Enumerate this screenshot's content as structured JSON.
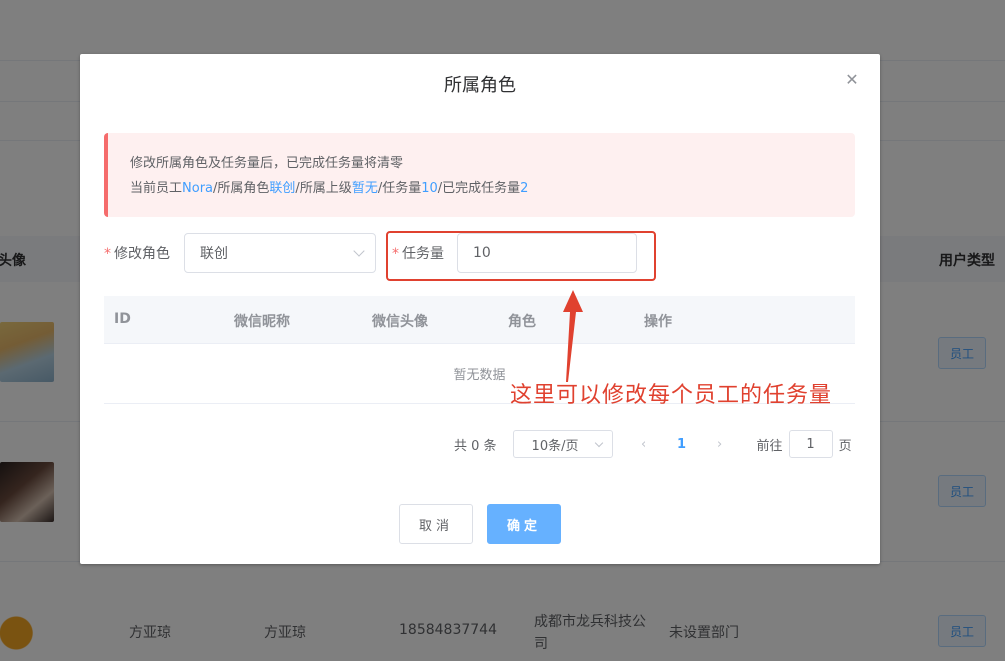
{
  "background": {
    "col_avatar_label": "头像",
    "col_usertype_label": "用户类型",
    "rows": [
      {
        "tag": "员工"
      },
      {
        "tag": "员工"
      },
      {
        "name": "方亚琼",
        "nickname": "方亚琼",
        "phone": "18584837744",
        "company_line1": "成都市龙兵科技公",
        "company_line2": "司",
        "department": "未设置部门",
        "tag": "员工"
      }
    ]
  },
  "dialog": {
    "title": "所属角色",
    "close_icon": "close-icon",
    "alert": {
      "line1": "修改所属角色及任务量后，已完成任务量将清零",
      "prefix_employee": "当前员工",
      "employee": "Nora",
      "prefix_role": "/所属角色",
      "role": "联创",
      "prefix_superior": "/所属上级",
      "superior": "暂无",
      "prefix_task": "/任务量",
      "task": "10",
      "prefix_done": "/已完成任务量",
      "done": "2"
    },
    "form": {
      "role_label": "修改角色",
      "role_value": "联创",
      "task_label": "任务量",
      "task_value": "10"
    },
    "table": {
      "columns": [
        "ID",
        "微信昵称",
        "微信头像",
        "角色",
        "操作"
      ],
      "empty_text": "暂无数据"
    },
    "pagination": {
      "total": "共 0 条",
      "page_size": "10条/页",
      "prev_icon": "‹",
      "current_page": "1",
      "next_icon": "›",
      "goto_label": "前往",
      "goto_value": "1",
      "goto_suffix": "页"
    },
    "buttons": {
      "cancel": "取消",
      "confirm": "确定"
    },
    "annotation": "这里可以修改每个员工的任务量"
  },
  "colors": {
    "primary": "#409eff",
    "danger": "#f56c6c",
    "annotation": "#e0412f"
  }
}
